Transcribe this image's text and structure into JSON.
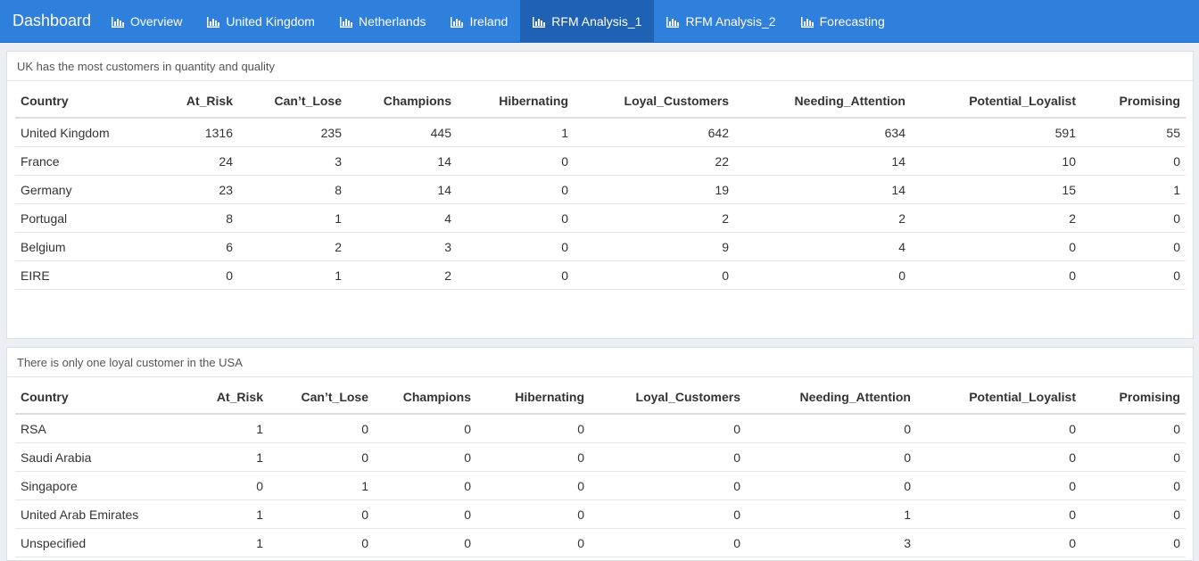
{
  "header": {
    "brand": "Dashboard",
    "tabs": [
      {
        "label": "Overview",
        "icon": "bar-chart-icon",
        "active": false
      },
      {
        "label": "United Kingdom",
        "icon": "bar-chart-icon",
        "active": false
      },
      {
        "label": "Netherlands",
        "icon": "bar-chart-icon",
        "active": false
      },
      {
        "label": "Ireland",
        "icon": "bar-chart-icon",
        "active": false
      },
      {
        "label": "RFM Analysis_1",
        "icon": "bar-chart-icon",
        "active": true
      },
      {
        "label": "RFM Analysis_2",
        "icon": "bar-chart-icon",
        "active": false
      },
      {
        "label": "Forecasting",
        "icon": "bar-chart-icon",
        "active": false
      }
    ]
  },
  "colors": {
    "navbar": "#2f7fdc",
    "active_tab": "#1f62b3"
  },
  "columns": [
    "Country",
    "At_Risk",
    "Can’t_Lose",
    "Champions",
    "Hibernating",
    "Loyal_Customers",
    "Needing_Attention",
    "Potential_Loyalist",
    "Promising"
  ],
  "table1": {
    "title": "UK has the most customers in quantity and quality",
    "rows": [
      [
        "United Kingdom",
        "1316",
        "235",
        "445",
        "1",
        "642",
        "634",
        "591",
        "55"
      ],
      [
        "France",
        "24",
        "3",
        "14",
        "0",
        "22",
        "14",
        "10",
        "0"
      ],
      [
        "Germany",
        "23",
        "8",
        "14",
        "0",
        "19",
        "14",
        "15",
        "1"
      ],
      [
        "Portugal",
        "8",
        "1",
        "4",
        "0",
        "2",
        "2",
        "2",
        "0"
      ],
      [
        "Belgium",
        "6",
        "2",
        "3",
        "0",
        "9",
        "4",
        "0",
        "0"
      ],
      [
        "EIRE",
        "0",
        "1",
        "2",
        "0",
        "0",
        "0",
        "0",
        "0"
      ]
    ]
  },
  "table2": {
    "title": "There is only one loyal customer in the USA",
    "rows": [
      [
        "RSA",
        "1",
        "0",
        "0",
        "0",
        "0",
        "0",
        "0",
        "0"
      ],
      [
        "Saudi Arabia",
        "1",
        "0",
        "0",
        "0",
        "0",
        "0",
        "0",
        "0"
      ],
      [
        "Singapore",
        "0",
        "1",
        "0",
        "0",
        "0",
        "0",
        "0",
        "0"
      ],
      [
        "United Arab Emirates",
        "1",
        "0",
        "0",
        "0",
        "0",
        "1",
        "0",
        "0"
      ],
      [
        "Unspecified",
        "1",
        "0",
        "0",
        "0",
        "0",
        "3",
        "0",
        "0"
      ]
    ]
  }
}
